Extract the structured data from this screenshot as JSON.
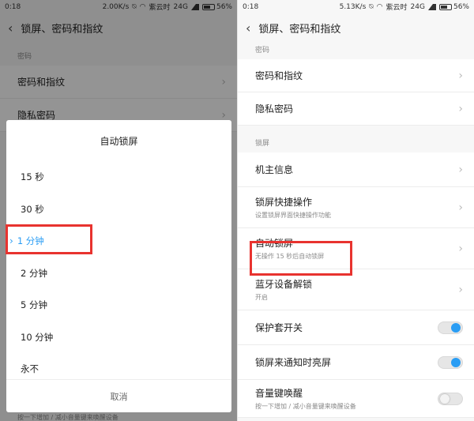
{
  "left": {
    "status": {
      "time": "0:18",
      "speed": "2.00K/s",
      "carrier": "紫云时",
      "network": "24G",
      "battery": "56%"
    },
    "title": "锁屏、密码和指纹",
    "section_password": "密码",
    "items": [
      {
        "label": "密码和指纹"
      },
      {
        "label": "隐私密码"
      }
    ],
    "dialog": {
      "title": "自动锁屏",
      "options": [
        "15 秒",
        "30 秒",
        "1 分钟",
        "2 分钟",
        "5 分钟",
        "10 分钟",
        "永不"
      ],
      "selected_index": 2,
      "cancel": "取消"
    },
    "bottom_hint": "按一下增加 / 减小音量键来唤醒设备"
  },
  "right": {
    "status": {
      "time": "0:18",
      "speed": "5.13K/s",
      "carrier": "紫云时",
      "network": "24G",
      "battery": "56%"
    },
    "title": "锁屏、密码和指纹",
    "section_password": "密码",
    "password_items": [
      {
        "label": "密码和指纹"
      },
      {
        "label": "隐私密码"
      }
    ],
    "section_lock": "锁屏",
    "lock_items": [
      {
        "label": "机主信息",
        "sub": ""
      },
      {
        "label": "锁屏快捷操作",
        "sub": "设置锁屏界面快捷操作功能"
      },
      {
        "label": "自动锁屏",
        "sub": "无操作 15 秒后自动锁屏"
      },
      {
        "label": "蓝牙设备解锁",
        "sub": "开启"
      }
    ],
    "toggles": [
      {
        "label": "保护套开关",
        "sub": "",
        "on": true
      },
      {
        "label": "锁屏来通知时亮屏",
        "sub": "",
        "on": true
      },
      {
        "label": "音量键唤醒",
        "sub": "按一下增加 / 减小音量键来唤醒设备",
        "on": false
      }
    ]
  },
  "colors": {
    "accent": "#2a9df4",
    "highlight": "#e8332f"
  },
  "icons": {
    "back": "chevron-left-icon",
    "chevron": "chevron-right-icon",
    "check": "selected-chevron-icon"
  }
}
